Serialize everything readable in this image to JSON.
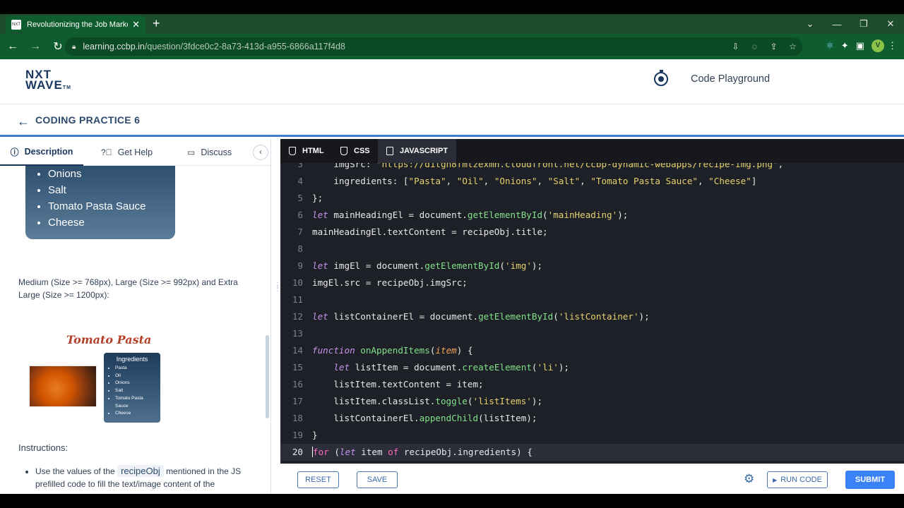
{
  "browser": {
    "tab_title": "Revolutionizing the Job Market |",
    "favicon_text": "NXT WAVE",
    "url_host": "learning.ccbp.in",
    "url_path": "/question/3fdce0c2-8a73-413d-a955-6866a117f4d8",
    "profile_initial": "V"
  },
  "header": {
    "logo_line1": "NXT",
    "logo_line2": "WAVE",
    "logo_tm": "TM",
    "playground_label": "Code Playground"
  },
  "subheader": {
    "title": "CODING PRACTICE 6"
  },
  "left": {
    "tabs": [
      {
        "label": "Description",
        "icon": "info-icon"
      },
      {
        "label": "Get Help",
        "icon": "question-circle-icon"
      },
      {
        "label": "Discuss",
        "icon": "chat-icon"
      }
    ],
    "card_items": [
      "Onions",
      "Salt",
      "Tomato Pasta Sauce",
      "Cheese"
    ],
    "description": "Medium (Size >= 768px), Large (Size >= 992px) and Extra Large (Size >= 1200px):",
    "preview": {
      "title": "Tomato Pasta",
      "ingredients_heading": "Ingredients",
      "ingredients": [
        "Pasta",
        "Oil",
        "Onions",
        "Salt",
        "Tomato Pasta Sauce",
        "Cheese"
      ]
    },
    "instructions_heading": "Instructions:",
    "bullet_pre": "Use the values of the",
    "bullet_code": "recipeObj",
    "bullet_post": "mentioned in the JS prefilled code to fill the text/image content of the"
  },
  "editor": {
    "tabs": [
      {
        "label": "HTML",
        "active": false
      },
      {
        "label": "CSS",
        "active": false
      },
      {
        "label": "JAVASCRIPT",
        "active": true
      }
    ],
    "current_line": "20"
  },
  "footer": {
    "reset": "RESET",
    "save": "SAVE",
    "run": "RUN CODE",
    "submit": "SUBMIT"
  },
  "colors": {
    "browser_green": "#0f5c2e",
    "brand_navy": "#17375e",
    "accent_blue": "#3b82f6",
    "editor_bg": "#1e2028"
  }
}
